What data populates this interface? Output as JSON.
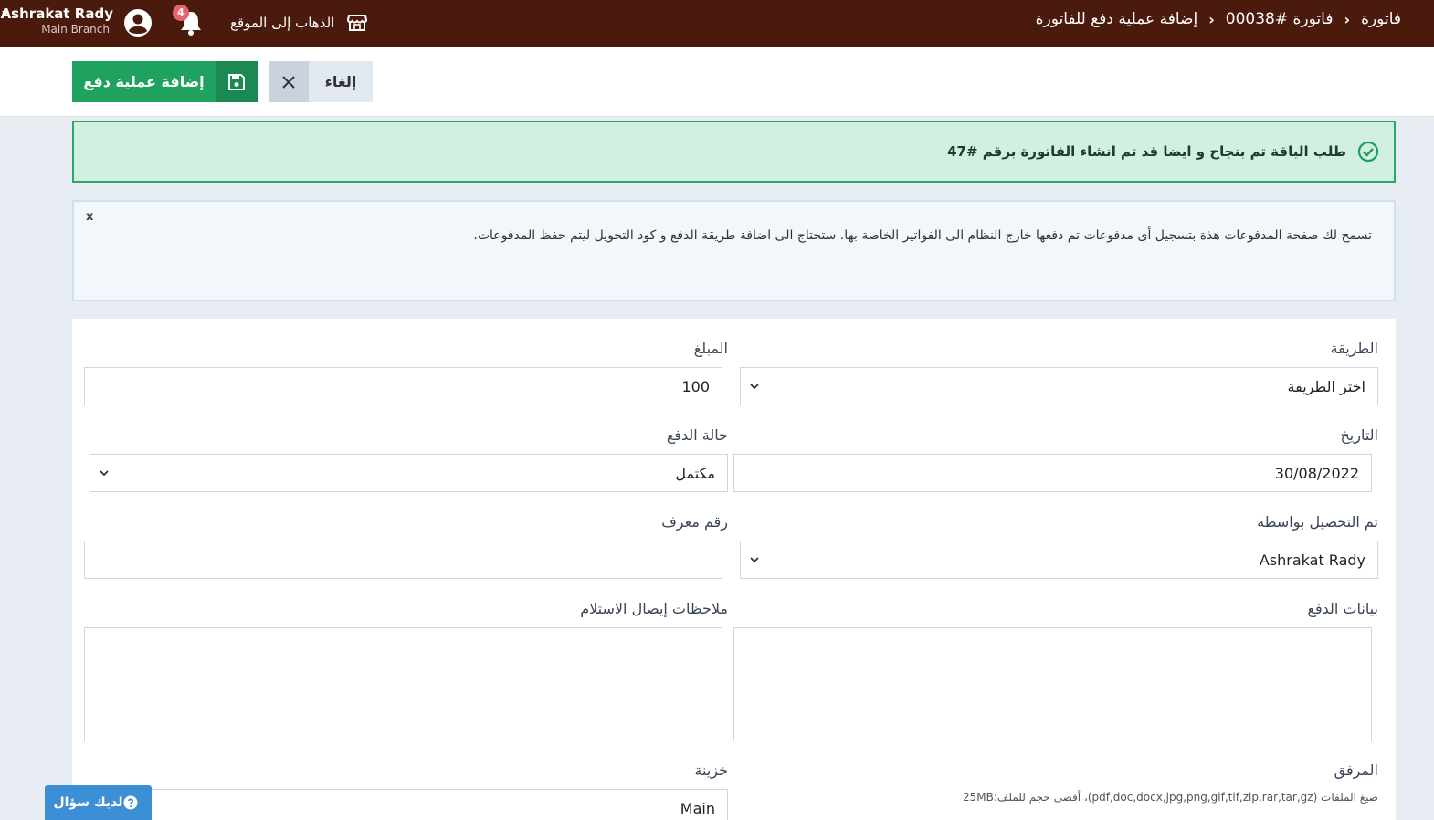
{
  "header": {
    "user_name": "Ashrakat Rady",
    "branch": "Main Branch",
    "notification_count": "4",
    "go_to_site": "الذهاب إلى الموقع",
    "breadcrumb": [
      "فاتورة",
      "فاتورة #00038",
      "إضافة عملية دفع للفاتورة"
    ]
  },
  "actions": {
    "save_label": "إضافة عملية دفع",
    "cancel_label": "إلغاء"
  },
  "alerts": {
    "success": "طلب الباقة تم بنجاح و ايضا قد تم انشاء الفاتورة برقم #47",
    "info_close": "x",
    "info": "تسمح لك صفحة المدفوعات هذة بتسجيل أى مدفوعات تم دفعها خارج النظام الى الفواتير الخاصة بها. ستحتاج الى اضافة طريقة الدفع و كود التحويل ليتم حفظ المدفوعات."
  },
  "form": {
    "method_label": "الطريقة",
    "method_value": "اختر الطريقة",
    "amount_label": "المبلغ",
    "amount_value": "100",
    "date_label": "التاريخ",
    "date_value": "30/08/2022",
    "status_label": "حالة الدفع",
    "status_value": "مكتمل",
    "collected_by_label": "تم التحصيل بواسطة",
    "collected_by_value": "Ashrakat Rady",
    "ref_label": "رقم معرف",
    "ref_value": "",
    "payment_details_label": "بيانات الدفع",
    "receipt_notes_label": "ملاحظات إيصال الاستلام",
    "attachment_label": "المرفق",
    "attachment_hint": "صيغ الملفات (pdf,doc,docx,jpg,png,gif,tif,zip,rar,tar,gz)، أقصى حجم للملف:25MB",
    "treasury_label": "خزينة",
    "treasury_value": "Main"
  },
  "help": {
    "label": "لديك سؤال"
  },
  "colors": {
    "topbar": "#4a1a0c",
    "primary_green": "#1fa160",
    "success_bg": "#d1f0e0",
    "help_blue": "#3c8fd4"
  }
}
